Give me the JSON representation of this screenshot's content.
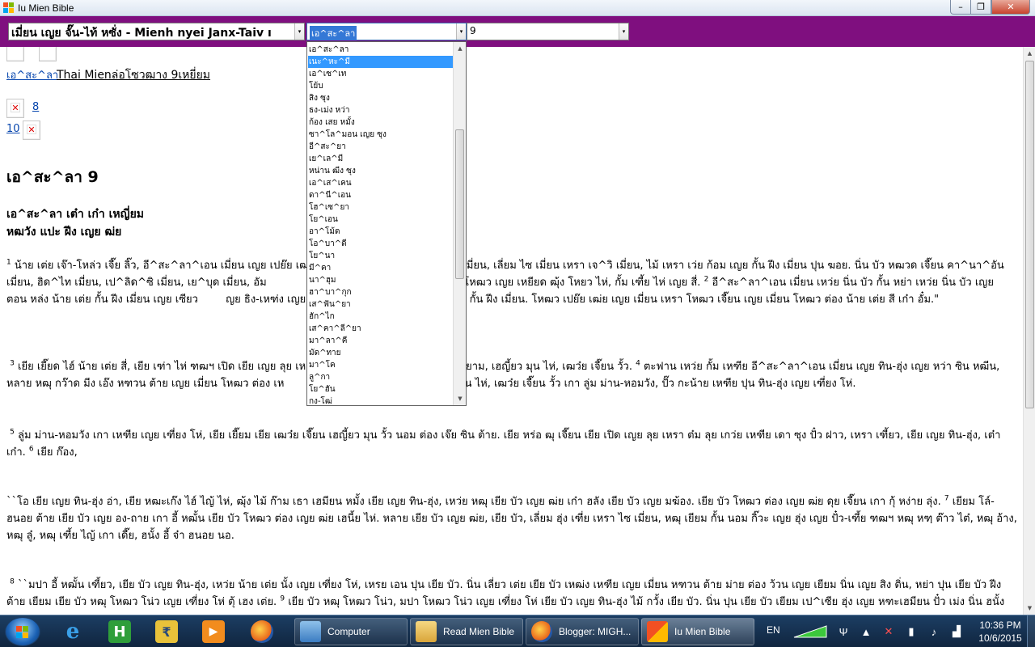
{
  "window": {
    "title": "Iu Mien Bible",
    "min_glyph": "–",
    "max_glyph": "❐",
    "close_glyph": "✕"
  },
  "toolbar": {
    "version_value": "เมี่ยน เญย จั๊น-ไท้ หซั่ง - Mienh nyei Janx-Taiv ı",
    "book_value": "เอ^สะ^ลา",
    "chapter_value": "9",
    "arrow_glyph": "▾"
  },
  "dropdown": {
    "items": [
      "เอ^สะ^ลา",
      "เนะ^หะ^มี",
      "เอ^เซ^เท",
      "โย้บ",
      "สิง ซุง",
      "ธง-เม่ง หว่า",
      "ก้อง เสย หมั้ง",
      "ซา^โล^มอน เญย ซุง",
      "อี^สะ^ยา",
      "เย^เล^มี",
      "หน่าน ฒีง ซุง",
      "เอ^เส^เคน",
      "ดา^นี^เอน",
      "โฮ^เซ^ยา",
      "โย^เอน",
      "อา^โม้ด",
      "โอ^บา^ดี",
      "โย^นา",
      "มี^คา",
      "นา^ฮุม",
      "ฮา^บา^กุก",
      "เส^ฟัน^ยา",
      "ฮัก^ไก",
      "เส^คา^ลี^ยา",
      "มา^ลา^คี",
      "มัด^ทาย",
      "มา^โค",
      "ลู^กา",
      "โย^ฮัน",
      "กง-โฒ่"
    ],
    "selected_index": 1
  },
  "page": {
    "nav_link_book": "เอ^สะ^ลา",
    "nav_thai": "Thai Mienล่อโซวฒาง 9เหยี่ยม",
    "nav_link_next": "8",
    "nav_link_prev": "10",
    "chapter_heading": "เอ^สะ^ลา 9",
    "section_heading_1": "เอ^สะ^ลา เต๋า เก๋า เหญี่ยม",
    "section_heading_2": "หฒวัง แปะ ฝีง เญย ฒ่ย",
    "paragraphs": [
      {
        "v1": "1",
        "t1": " น้าย เต่ย เจ๊า-โหล่ว เจี๊ย ลิ๊ว, อี^สะ^ลา^เอน เมี่ยน เญย เปย๊ย เฒ่ย ต่ ",
        "t2": "^เอน เมี่ยน, เลี่ยม ไซ เมี่ยน เหรา เจ^วิ เมี่ยน, ไม้ เหรา เว่ย ก้อม เญย กั้น ฝีง เมี่ยน ปุน ฆอย. นิ่น บัว หฒวด เจี๊ยน คา^นา^อัน เมี่ยน, ฮิด^ไท เมี่ยน, เป^ลิด^ซิ เมี่ยน, เย^บุด เมี่ยน, อัม",
        "t3": "มี่ยน, เหรา อา^โม^ไล เมี่ยน โหฒว เญย เหยียด ฒุ้ง โหยว ไห่, กั้ม เฑี้ย ไห่ เญย สี่.",
        "v2": "2",
        "t4": " อี^สะ^ลา^เอน เมี่ยน เหว่ย นิ่น บัว กั้น หย่า เหว่ย นิ่น บัว เญย ตอน หล่ง น้าย เต่ย กั้น ฝีง เมี่ยน เญย เซียว ",
        "t5": "ญย ธิง-เหฑ่ง เญย แปะ ฝีง หฒอบ เจี๊ยน เว่ย ก้อม เญย กั้น ฝีง เมี่ยน. โหฒว เปย๊ย เฒ่ย เญย เมี่ยน เหรา โหฒว เจี๊ยน เญย เมี่ยน โหฒว ต่อง น้าย เต่ย สี เก๋า อั๋ม.\""
      },
      {
        "v1": "3",
        "t1": " เยีย เยี๊ยด ไฮ์ น้าย เต่ย สี่, เยีย เฑ่า ไห่ ฑฒฯ เปิด เยีย เญย ลุย เห",
        "t2": "ปยย เหรา ซยาม, เฮญี้ยว มุน ไห่, เฒว๋ย เจี๊ยน วั้ว.",
        "v2": "4",
        "t3": " ตะฟาน เหว่ย กั้ม เหฑีย อี^สะ^ลา^เอน เมี่ยน เญย ทิน-ฮุ่ง เญย หว่า ซิน หฒีน, หลาย หฒุ กว๊าด มีง เอ๊ง หฑวน ต้าย เญย เมี่ยน โหฒว ต่อง เห",
        "t4": ". เยีย เฮญี้ยว มุน ไห่, เฒว๋ย เจี๊ยน วั้ว เกา ลู่ม ม่าน-หอมวัง, ปั๊ว กะน้าย เหฑีย ปุน ทิน-ฮุ่ง เญย เฑี่ยง โห่."
      },
      {
        "v1": "5",
        "t1": " ลู่ม ม่าน-หอมวัง เกา เหฑีย เญย เฑี่ยง โห่, เยีย เยี๊ยม เยีย เฒว๋ย เจี๊ยน เฮญี้ยว มุน วั้ว นอม ต่อง เจ๊ย ซิน ต้าย. เยีย หร่อ ฒุ เจี๊ยน เยีย เปิด เญย ลุย เหรา ต๋ม ลุย เกว่ย เหฑีย เดา ซุง ปั๋ว ฝาว, เหรา  เฑี้ยว,  เยีย เญย ทิน-ฮุ่ง, เต๋า เก๋า.",
        "v2": "6",
        "t2": " เยีย ก๊อง,"
      },
      {
        "t1": "``โอ เยีย เญย ทิน-ฮุ่ง อ่า, เยีย หฒะเก๊ง ไฮ์ ไญ้ ไห่, ฒุ้ง ไม้ ก๊าม เธา เฮมียน หมั้ง เยีย เญย ทิน-ฮุ่ง, เหว่ย หฒุ เยีย บัว เญย ฒ่ย เก๋า ฮลัง เยีย บัว เญย มฆ้อง. เยีย บัว โหฒว ต่อง เญย ฒ่ย ดุย เจี๊ยน เกา กุ้ หง่าย ลุ่ง.",
        "v1": "7",
        "t2": " เยียม โล์-ฮนอย ต้าย เยีย บัว เญย อง-ถาย เกา อี้ หฒั้น เยีย บัว โหฒว ต่อง เญย ฒ่ย เฮนี้ย ไห่. หลาย เยีย บัว เญย ฒ่ย, เยีย บัว, เลี่ยม ฮุ่ง เฑี่ย เหรา ไซ เมี่ยน, หฒุ เยียม กั้น นอม กิ๊วะ เญย ฮุ่ง เญย ปั๋ว-เฑี้ย ฑฒฯ หฒุ หฑฺ ต๊าว ไต๋, หฒุ อ้าง, หฒุ ลู๋, หฒุ เฑี้ย ไญ้ เกา เดี๊ย, ฮนั้ง อี้ จ๋า ฮนอย นอ."
      },
      {
        "v1": "8",
        "t1": " ``มปา อี้ หฒั้น  เฑี้ยว,  เยีย บัว เญย ทิน-ฮุ่ง, เหว่ย น้าย เต่ย นั้ง เญย เฑี่ยง โห่, เหรย เอน ปุน เยีย บัว. นิ่น เลี่ยว เต่ย เยีย บัว เหฒ่ง เหฑีย เญย เมี่ยน หฑวน ต้าย ม่าย ต่อง ว้วน เญย เยียม นิ่น เญย สิง ติ่น, หย่า ปุน เยีย บัว ฝีง ต้าย เยียม เยีย บัว หฒุ โหฒว โน่ว เญย เฑี่ยง โห่ ตุ้ เฮง เต่ย.",
        "v2": "9",
        "t2": " เยีย บัว หฒุ โหฒว โน่ว, มปา โหฒว โน่ว เญย เฑี่ยง โห่ เยีย บัว เญย ทิน-ฮุ่ง ไม้ กวั้ง เยีย บัว. นิ่น ปุน เยีย บัว เยียม เป^เซีย ฮุ่ง เญย หฑะเฮมียน ปั๋ว เม่ง นิ่น ฮนั้ง"
      }
    ]
  },
  "taskbar": {
    "start_label": "Start",
    "pinned": [
      "Internet Explorer",
      "H",
      "Rupee",
      "Media",
      "Firefox"
    ],
    "tasks": [
      {
        "label": "Computer"
      },
      {
        "label": "Read Mien Bible"
      },
      {
        "label": "Blogger: MIGH..."
      },
      {
        "label": "Iu Mien Bible"
      }
    ],
    "language": "EN",
    "time": "10:36 PM",
    "date": "10/6/2015"
  },
  "colors": {
    "toolbar_bg": "#7f0f7f",
    "selection": "#3399ff",
    "link": "#0645ad",
    "taskbar_bg": "#10253f"
  }
}
